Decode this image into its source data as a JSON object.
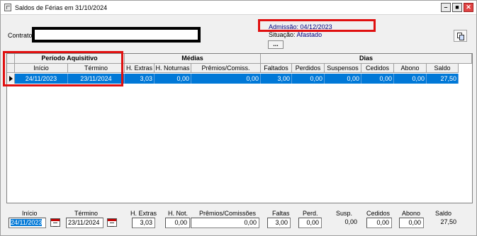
{
  "window": {
    "title": "Saldos de Férias em 31/10/2024",
    "controls": {
      "minimize": "–",
      "maximize": "■",
      "close": "✕"
    }
  },
  "header": {
    "contrato_label": "Contrato",
    "admissao_label": "Admissão:",
    "admissao_value": "04/12/2023",
    "situacao_label": "Situação:",
    "situacao_value": "Afastado",
    "dots_button": "...",
    "copy_icon": "copy-icon"
  },
  "grid": {
    "groups": {
      "periodo": "Período Aquisitivo",
      "medias": "Médias",
      "dias": "Dias"
    },
    "columns": [
      "Início",
      "Término",
      "H. Extras",
      "H. Noturnas",
      "Prêmios/Comiss.",
      "Faltados",
      "Perdidos",
      "Suspensos",
      "Cedidos",
      "Abono",
      "Saldo"
    ],
    "rows": [
      [
        "24/11/2023",
        "23/11/2024",
        "3,03",
        "0,00",
        "0,00",
        "3,00",
        "0,00",
        "0,00",
        "0,00",
        "0,00",
        "27,50"
      ]
    ]
  },
  "footer": {
    "labels": {
      "inicio": "Início",
      "termino": "Término",
      "h_extras": "H. Extras",
      "h_not": "H. Not.",
      "premios": "Prêmios/Comissões",
      "faltas": "Faltas",
      "perd": "Perd.",
      "susp": "Susp.",
      "cedidos": "Cedidos",
      "abono": "Abono",
      "saldo": "Saldo"
    },
    "values": {
      "inicio": "24/11/2023",
      "termino": "23/11/2024",
      "h_extras": "3,03",
      "h_not": "0,00",
      "premios": "0,00",
      "faltas": "3,00",
      "perd": "0,00",
      "susp": "0,00",
      "cedidos": "0,00",
      "abono": "0,00",
      "saldo": "27,50"
    }
  },
  "colors": {
    "selection": "#0078d7",
    "highlight_annotation": "#e01010",
    "info_text": "#000080"
  }
}
